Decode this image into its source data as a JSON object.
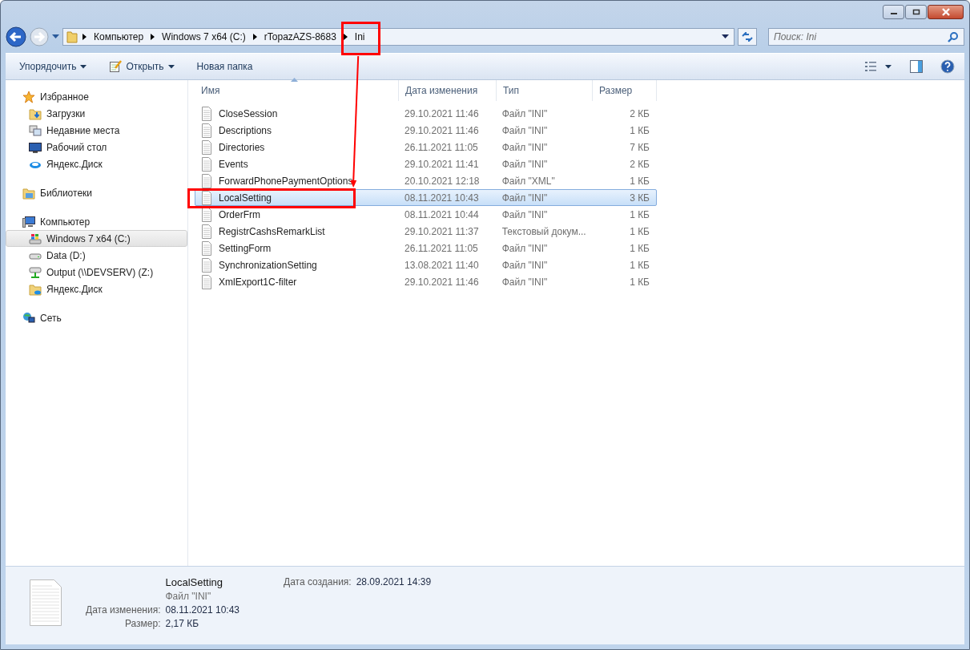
{
  "address": {
    "crumbs": [
      {
        "label": "Компьютер",
        "highlighted": false
      },
      {
        "label": "Windows 7 x64 (C:)",
        "highlighted": false
      },
      {
        "label": "rTopazAZS-8683",
        "highlighted": false
      },
      {
        "label": "Ini",
        "highlighted": true
      }
    ]
  },
  "search": {
    "placeholder": "Поиск: Ini"
  },
  "toolbar": {
    "buttons": [
      {
        "label": "Упорядочить",
        "kind": "menu"
      },
      {
        "label": "Открыть",
        "kind": "open"
      },
      {
        "label": "Новая папка",
        "kind": "plain"
      }
    ]
  },
  "sidebar": {
    "groups": [
      {
        "label": "Избранное",
        "kind": "star",
        "children": [
          {
            "label": "Загрузки",
            "kind": "downloads",
            "selected": false
          },
          {
            "label": "Недавние места",
            "kind": "recent",
            "selected": false
          },
          {
            "label": "Рабочий стол",
            "kind": "desktop",
            "selected": false
          },
          {
            "label": "Яндекс.Диск",
            "kind": "cloud",
            "selected": false
          }
        ]
      },
      {
        "label": "Библиотеки",
        "kind": "libraries"
      },
      {
        "label": "Компьютер",
        "kind": "computer",
        "children": [
          {
            "label": "Windows 7 x64 (C:)",
            "kind": "system-drive",
            "selected": true
          },
          {
            "label": "Data (D:)",
            "kind": "drive",
            "selected": false
          },
          {
            "label": "Output (\\\\DEVSERV) (Z:)",
            "kind": "network-drive",
            "selected": false
          },
          {
            "label": "Яндекс.Диск",
            "kind": "cloud-folder",
            "selected": false
          }
        ]
      },
      {
        "label": "Сеть",
        "kind": "network"
      }
    ]
  },
  "table": {
    "columns": [
      {
        "label": "Имя",
        "sorted": true
      },
      {
        "label": "Дата изменения",
        "sorted": false
      },
      {
        "label": "Тип",
        "sorted": false
      },
      {
        "label": "Размер",
        "sorted": false
      }
    ],
    "rows": [
      {
        "name": "CloseSession",
        "date": "29.10.2021 11:46",
        "type": "Файл \"INI\"",
        "size": "2 КБ",
        "selected": false,
        "highlighted": false
      },
      {
        "name": "Descriptions",
        "date": "29.10.2021 11:46",
        "type": "Файл \"INI\"",
        "size": "1 КБ",
        "selected": false,
        "highlighted": false
      },
      {
        "name": "Directories",
        "date": "26.11.2021 11:05",
        "type": "Файл \"INI\"",
        "size": "7 КБ",
        "selected": false,
        "highlighted": false
      },
      {
        "name": "Events",
        "date": "29.10.2021 11:41",
        "type": "Файл \"INI\"",
        "size": "2 КБ",
        "selected": false,
        "highlighted": false
      },
      {
        "name": "ForwardPhonePaymentOptions",
        "date": "20.10.2021 12:18",
        "type": "Файл \"XML\"",
        "size": "1 КБ",
        "selected": false,
        "highlighted": false
      },
      {
        "name": "LocalSetting",
        "date": "08.11.2021 10:43",
        "type": "Файл \"INI\"",
        "size": "3 КБ",
        "selected": true,
        "highlighted": true
      },
      {
        "name": "OrderFrm",
        "date": "08.11.2021 10:44",
        "type": "Файл \"INI\"",
        "size": "1 КБ",
        "selected": false,
        "highlighted": false
      },
      {
        "name": "RegistrCashsRemarkList",
        "date": "29.10.2021 11:37",
        "type": "Текстовый докум...",
        "size": "1 КБ",
        "selected": false,
        "highlighted": false
      },
      {
        "name": "SettingForm",
        "date": "26.11.2021 11:05",
        "type": "Файл \"INI\"",
        "size": "1 КБ",
        "selected": false,
        "highlighted": false
      },
      {
        "name": "SynchronizationSetting",
        "date": "13.08.2021 11:40",
        "type": "Файл \"INI\"",
        "size": "1 КБ",
        "selected": false,
        "highlighted": false
      },
      {
        "name": "XmlExport1C-filter",
        "date": "29.10.2021 11:46",
        "type": "Файл \"INI\"",
        "size": "1 КБ",
        "selected": false,
        "highlighted": false
      }
    ]
  },
  "details": {
    "name": "LocalSetting",
    "type": "Файл \"INI\"",
    "fields": [
      {
        "label": "Дата изменения:",
        "value": "08.11.2021 10:43"
      },
      {
        "label": "Размер:",
        "value": "2,17 КБ"
      }
    ],
    "side_fields": [
      {
        "label": "Дата создания:",
        "value": "28.09.2021 14:39"
      }
    ]
  }
}
